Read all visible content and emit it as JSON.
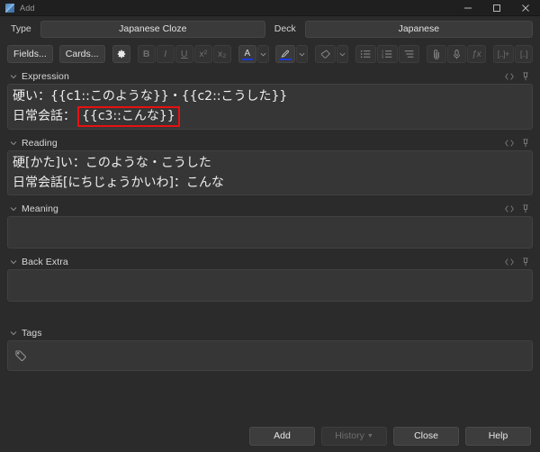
{
  "window": {
    "title": "Add",
    "icon": "anki-app-icon",
    "controls": {
      "minimize": "minimize-icon",
      "maximize": "maximize-icon",
      "close": "close-icon"
    }
  },
  "notetype_row": {
    "type_label": "Type",
    "type_value": "Japanese Cloze",
    "deck_label": "Deck",
    "deck_value": "Japanese"
  },
  "toolbar": {
    "fields_label": "Fields...",
    "cards_label": "Cards...",
    "settings_icon": "gear-icon",
    "bold_label": "B",
    "italic_label": "I",
    "underline_label": "U",
    "superscript_label": "x²",
    "subscript_label": "x₂",
    "text_color_label": "A",
    "text_color_chevron": "chevron-down-icon",
    "highlight_icon": "pen-icon",
    "highlight_chevron": "chevron-down-icon",
    "remove_format_icon": "eraser-icon",
    "remove_format_chevron": "chevron-down-icon",
    "unordered_list_icon": "bullet-list-icon",
    "ordered_list_icon": "numbered-list-icon",
    "align_icon": "text-align-icon",
    "attach_icon": "paperclip-icon",
    "record_icon": "microphone-icon",
    "mathjax_label": "ƒx",
    "cloze_new_label": "[..]+",
    "cloze_same_label": "[..]",
    "accent_color": "#1a38d8"
  },
  "fields": [
    {
      "name": "Expression",
      "collapse_icon": "chevron-down-icon",
      "html_icon": "html-editor-icon",
      "pin_icon": "pin-icon",
      "lines": [
        {
          "text": "硬い：{{c1::このような}}・{{c2::こうした}}",
          "highlighted": null
        },
        {
          "text": "日常会話：",
          "highlighted": "{{c3::こんな}}"
        }
      ]
    },
    {
      "name": "Reading",
      "collapse_icon": "chevron-down-icon",
      "html_icon": "html-editor-icon",
      "pin_icon": "pin-icon",
      "lines": [
        {
          "text": "硬[かた]い：このような・こうした",
          "highlighted": null
        },
        {
          "text": "日常会話[にちじょうかいわ]：こんな",
          "highlighted": null
        }
      ]
    },
    {
      "name": "Meaning",
      "collapse_icon": "chevron-down-icon",
      "html_icon": "html-editor-icon",
      "pin_icon": "pin-icon",
      "lines": []
    },
    {
      "name": "Back Extra",
      "collapse_icon": "chevron-down-icon",
      "html_icon": "html-editor-icon",
      "pin_icon": "pin-icon",
      "lines": []
    }
  ],
  "tags": {
    "label": "Tags",
    "collapse_icon": "chevron-down-icon",
    "icon": "tag-icon",
    "value": "",
    "placeholder": ""
  },
  "bottom_buttons": {
    "add": "Add",
    "history": "History",
    "history_chevron": "▼",
    "close": "Close",
    "help": "Help"
  },
  "annotation": {
    "highlight_color": "#e81010",
    "target": "{{c3::こんな}}"
  }
}
